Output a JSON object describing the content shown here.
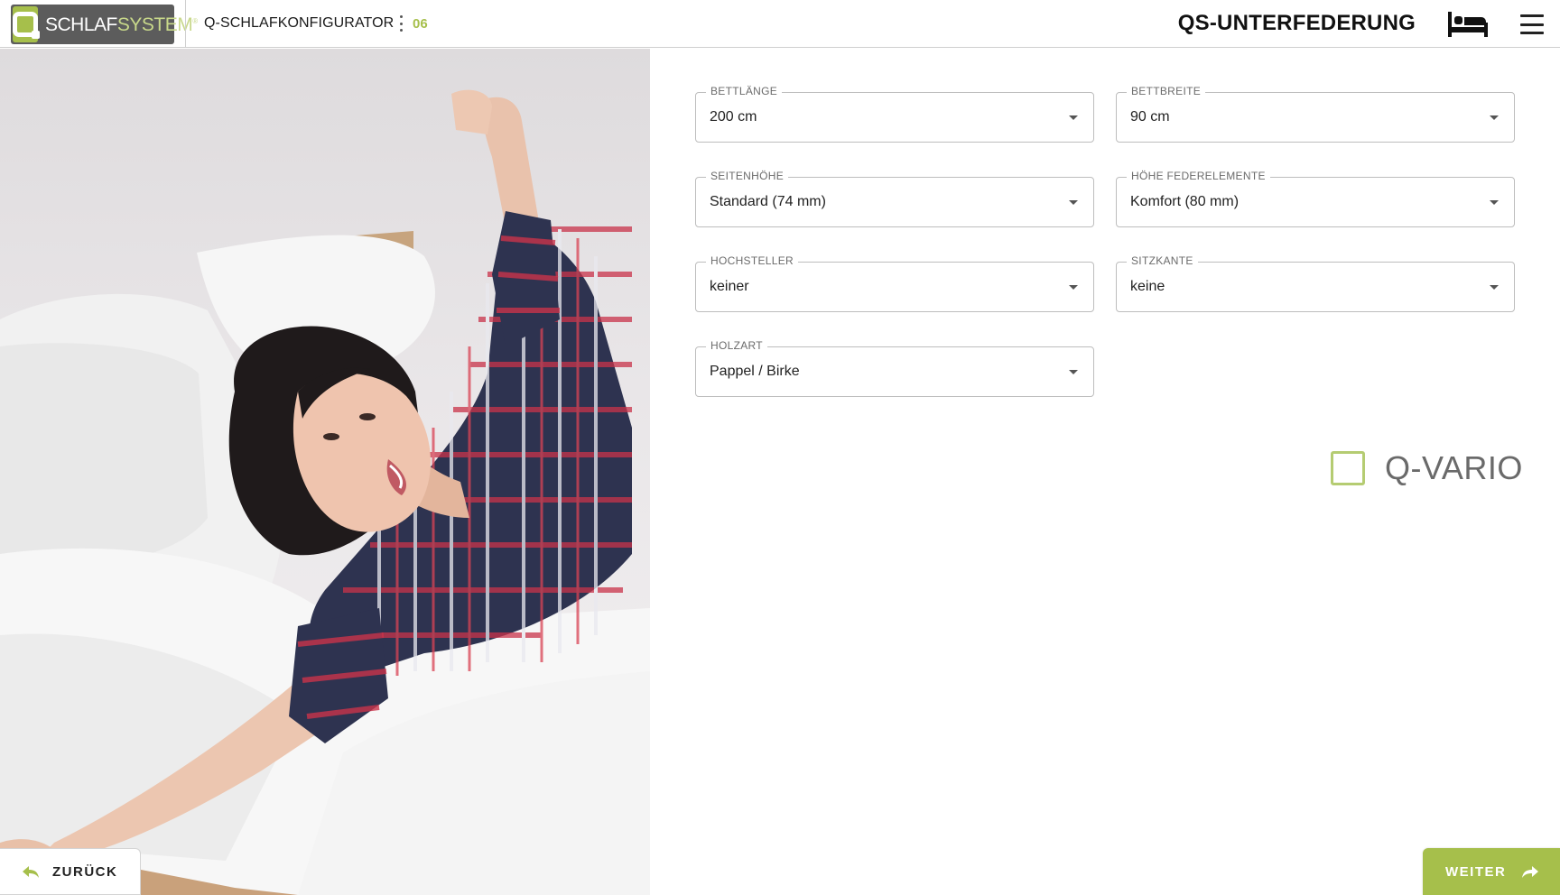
{
  "header": {
    "logo_text_white": "SCHLAF",
    "logo_text_green": "SYSTEM",
    "logo_mark": "®",
    "app_title": "Q-SCHLAFKONFIGURATOR",
    "step": "06",
    "section_title": "QS-UNTERFEDERUNG",
    "icons": [
      "bed-icon",
      "menu-icon",
      "more-vert-icon"
    ]
  },
  "photo": {
    "alt": "woman-waking-up-in-bed"
  },
  "form": {
    "fields": [
      {
        "label": "BETTLÄNGE",
        "value": "200 cm"
      },
      {
        "label": "BETTBREITE",
        "value": "90 cm"
      },
      {
        "label": "SEITENHÖHE",
        "value": "Standard (74 mm)"
      },
      {
        "label": "HÖHE FEDERELEMENTE",
        "value": "Komfort (80 mm)"
      },
      {
        "label": "HOCHSTELLER",
        "value": "keiner"
      },
      {
        "label": "SITZKANTE",
        "value": "keine"
      },
      {
        "label": "HOLZART",
        "value": "Pappel / Birke"
      }
    ],
    "vario": {
      "label": "Q-VARIO",
      "checked": false
    }
  },
  "nav": {
    "back_label": "ZURÜCK",
    "next_label": "WEITER"
  },
  "colors": {
    "accent": "#a6bf4b",
    "logo_bg": "#5c5c5c",
    "checkbox_border": "#b5cc72"
  }
}
